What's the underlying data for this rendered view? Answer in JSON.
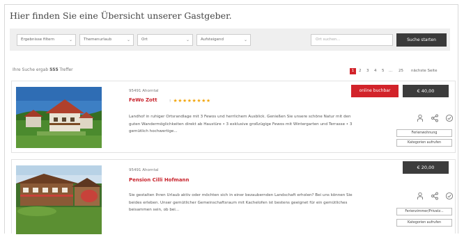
{
  "page": {
    "title": "Hier finden Sie eine Übersicht unserer Gastgeber."
  },
  "filters": {
    "selects": [
      {
        "label": "Ergebnisse filtern"
      },
      {
        "label": "Themenurlaub"
      },
      {
        "label": "Ort"
      },
      {
        "label": "Aufsteigend"
      }
    ],
    "search_placeholder": "Ort suchen...",
    "search_button": "Suche starten"
  },
  "results": {
    "prefix": "Ihre Suche ergab",
    "count": "555",
    "suffix": "Treffer"
  },
  "pager": {
    "pages": [
      "1",
      "2",
      "3",
      "4",
      "5",
      "...",
      "25"
    ],
    "active": "1",
    "next_label": "nächste Seite"
  },
  "listings": [
    {
      "location": "95491 Ahorntal",
      "name": "FeWo Zott",
      "stars": "★★★★★★★★",
      "star_prefix": "!",
      "description": "Landhof in ruhiger Ortsrandlage mit 3 Fewos und herrlichem Ausblick. Genießen Sie unsere schöne Natur mit den guten Wandermöglichkeiten direkt ab Haustüre • 3 exklusive großzügige Fewos mit Wintergarten und Terrasse • 3 gemütlich hochwertige...",
      "book_label": "online buchbar",
      "price": "€ 40,00",
      "buttons": [
        "Ferienwohnung",
        "Kategorien aufrufen"
      ]
    },
    {
      "location": "95491 Ahorntal",
      "name": "Pension Cilli Hofmann",
      "description": "Sie gestalten Ihren Urlaub aktiv oder möchten sich in einer bezaubernden Landschaft erholen? Bei uns können Sie beides erleben. Unser gemütlicher Gemeinschaftsraum mit Kachelofen ist bestens geeignet für ein gemütliches beisammen sein, ob bei...",
      "price": "€ 20,00",
      "buttons": [
        "Ferienzimmer/Privatz...",
        "Kategorien aufrufen"
      ]
    }
  ],
  "colors": {
    "accent": "#d2232a",
    "dark_button": "#3c3c3c",
    "star": "#f2a60f"
  }
}
